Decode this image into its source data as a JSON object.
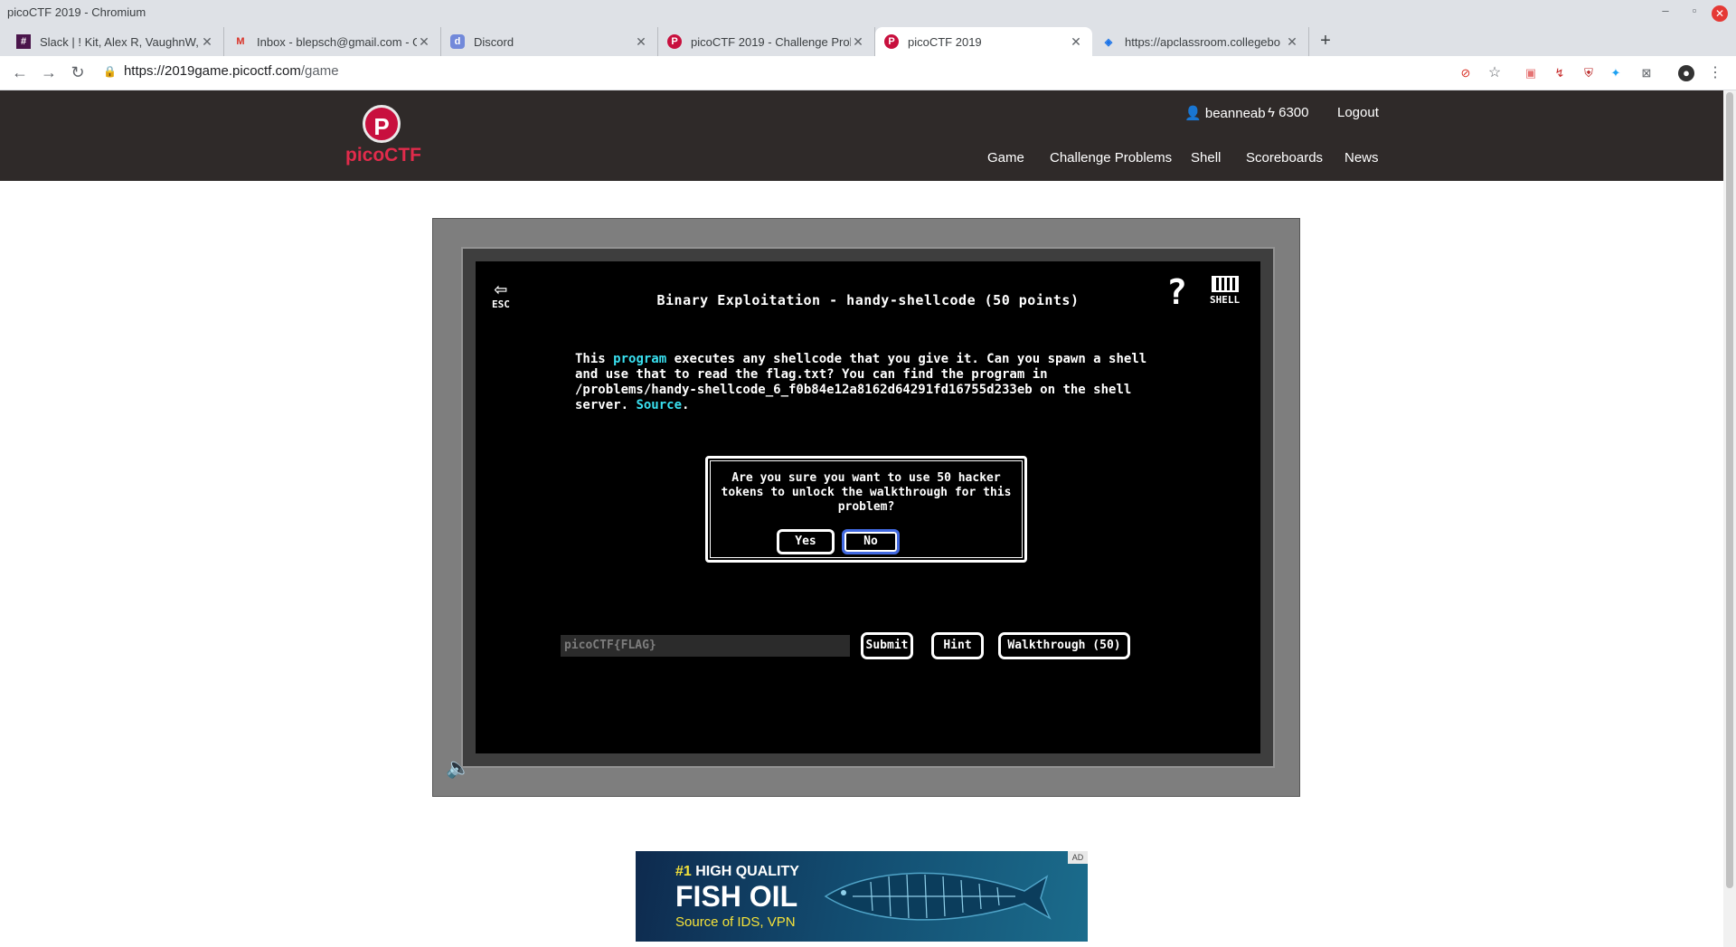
{
  "window": {
    "title": "picoCTF 2019 - Chromium",
    "min": "–",
    "max": "▫",
    "close": "✕"
  },
  "tabs": [
    {
      "label": "Slack | ! Kit, Alex R, VaughnW, ",
      "icon": "slack-icon",
      "close": "✕"
    },
    {
      "label": "Inbox - blepsch@gmail.com - G",
      "icon": "gmail-icon",
      "close": "✕"
    },
    {
      "label": "Discord",
      "icon": "discord-icon",
      "close": "✕"
    },
    {
      "label": "picoCTF 2019 - Challenge Prob",
      "icon": "picoctf-icon",
      "close": "✕"
    },
    {
      "label": "picoCTF 2019",
      "icon": "picoctf-icon",
      "close": "✕"
    },
    {
      "label": "https://apclassroom.collegebo",
      "icon": "shield-icon",
      "close": "✕"
    }
  ],
  "newtab": "+",
  "toolbar": {
    "back": "←",
    "forward": "→",
    "reload": "↻",
    "url_host": "https://2019game.picoctf.com",
    "url_path": "/game",
    "bookmark": "☆",
    "menu": "⋮"
  },
  "site": {
    "logo_letter": "P",
    "logo_text": "picoCTF",
    "username": "beanneab",
    "tokens": "6300",
    "logout": "Logout",
    "nav": [
      "Game",
      "Challenge Problems",
      "Shell",
      "Scoreboards",
      "News"
    ]
  },
  "game": {
    "esc_label": "ESC",
    "esc_arrow": "⇦",
    "help": "?",
    "shell_label": "SHELL",
    "title": "Binary Exploitation - handy-shellcode (50 points)",
    "desc": {
      "p1": "This ",
      "link1": "program",
      "p2": " executes any shellcode that you give it. Can you spawn a shell and use that to read the flag.txt? You can find the program in /problems/handy-shellcode_6_f0b84e12a8162d64291fd16755d233eb on the shell server. ",
      "link2": "Source",
      "p3": "."
    },
    "dialog": {
      "message": "Are you sure you want to use 50 hacker tokens to unlock the walkthrough for this problem?",
      "yes": "Yes",
      "no": "No"
    },
    "flag_placeholder": "picoCTF{FLAG}",
    "submit": "Submit",
    "hint": "Hint",
    "walkthrough": "Walkthrough (50)",
    "speaker": "🔈"
  },
  "ad": {
    "line1_highlight": "#1",
    "line1": " HIGH QUALITY",
    "line2": "FISH OIL",
    "line3": "Source of IDS, VPN",
    "badge": "AD"
  }
}
